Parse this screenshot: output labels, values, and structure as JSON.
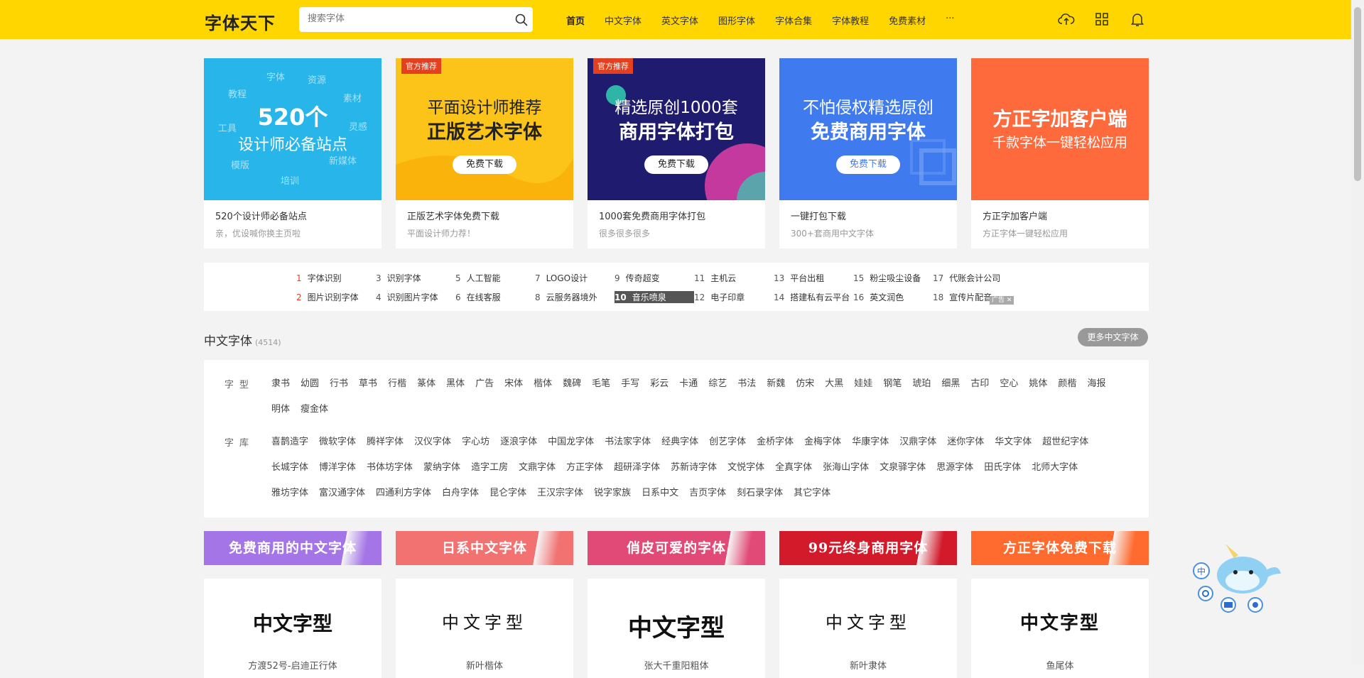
{
  "header": {
    "logo": "字体天下",
    "search_placeholder": "搜索字体",
    "nav": [
      "首页",
      "中文字体",
      "英文字体",
      "图形字体",
      "字体合集",
      "字体教程",
      "免费素材",
      "···"
    ],
    "icons": [
      "upload-cloud-icon",
      "grid-apps-icon",
      "bell-icon"
    ],
    "accent_color": "#ffd600"
  },
  "banners": [
    {
      "bg": "#28b6ea",
      "tag": "",
      "line1": "520个",
      "line2": "设计师必备站点",
      "button": "",
      "title": "520个设计师必备站点",
      "subtitle": "亲，优设喊你换主页啦",
      "words": [
        "字体",
        "教程",
        "资源",
        "素材",
        "工具",
        "灵感",
        "模版",
        "新媒体",
        "培训"
      ]
    },
    {
      "bg": "#fcc419",
      "tag": "官方推荐",
      "line1": "平面设计师推荐",
      "line2": "正版艺术字体",
      "button": "免费下载",
      "title": "正版艺术字体免费下载",
      "subtitle": "平面设计师力荐！"
    },
    {
      "bg": "#1f1b6e",
      "tag": "官方推荐",
      "line1": "精选原创1000套",
      "line2": "商用字体打包",
      "button": "免费下载",
      "title": "1000套免费商用字体打包",
      "subtitle": "很多很多很多"
    },
    {
      "bg": "#3f7bee",
      "tag": "",
      "line1": "不怕侵权精选原创",
      "line2": "免费商用字体",
      "button": "免费下载",
      "title": "一键打包下载",
      "subtitle": "300+套商用中文字体"
    },
    {
      "bg": "#ff6a3d",
      "tag": "",
      "line1": "千款字体一键轻松应用",
      "line2": "方正字加客户端",
      "button": "",
      "title": "方正字加客户端",
      "subtitle": "方正字体一键轻松应用"
    }
  ],
  "hot_searches": [
    {
      "rank": "1",
      "text": "字体识别"
    },
    {
      "rank": "3",
      "text": "识别字体"
    },
    {
      "rank": "5",
      "text": "人工智能"
    },
    {
      "rank": "7",
      "text": "LOGO设计"
    },
    {
      "rank": "9",
      "text": "传奇超变"
    },
    {
      "rank": "11",
      "text": "主机云"
    },
    {
      "rank": "13",
      "text": "平台出租"
    },
    {
      "rank": "15",
      "text": "粉尘吸尘设备"
    },
    {
      "rank": "17",
      "text": "代账会计公司"
    },
    {
      "rank": "2",
      "text": "图片识别字体"
    },
    {
      "rank": "4",
      "text": "识别图片字体"
    },
    {
      "rank": "6",
      "text": "在线客服"
    },
    {
      "rank": "8",
      "text": "云服务器境外"
    },
    {
      "rank": "10",
      "text": "音乐喷泉"
    },
    {
      "rank": "12",
      "text": "电子印章"
    },
    {
      "rank": "14",
      "text": "搭建私有云平台"
    },
    {
      "rank": "16",
      "text": "英文润色"
    },
    {
      "rank": "18",
      "text": "宣传片配音"
    }
  ],
  "ad_badge": "广告 ✕",
  "section": {
    "title": "中文字体",
    "count": "(4514)",
    "more": "更多中文字体"
  },
  "filters": {
    "type_label": "字型",
    "types": [
      "隶书",
      "幼圆",
      "行书",
      "草书",
      "行楷",
      "篆体",
      "黑体",
      "广告",
      "宋体",
      "楷体",
      "魏碑",
      "毛笔",
      "手写",
      "彩云",
      "卡通",
      "综艺",
      "书法",
      "新魏",
      "仿宋",
      "大黑",
      "娃娃",
      "钢笔",
      "琥珀",
      "细黑",
      "古印",
      "空心",
      "姚体",
      "颜楷",
      "海报",
      "明体",
      "瘦金体"
    ],
    "lib_label": "字库",
    "libs": [
      "喜鹊造字",
      "微软字体",
      "腾祥字体",
      "汉仪字体",
      "字心坊",
      "逐浪字体",
      "中国龙字体",
      "书法家字体",
      "经典字体",
      "创艺字体",
      "金桥字体",
      "金梅字体",
      "华康字体",
      "汉鼎字体",
      "迷你字体",
      "华文字体",
      "超世纪字体",
      "长城字体",
      "博洋字体",
      "书体坊字体",
      "蒙纳字体",
      "造字工房",
      "文鼎字体",
      "方正字体",
      "超研泽字体",
      "苏新诗字体",
      "文悦字体",
      "全真字体",
      "张海山字体",
      "文泉驿字体",
      "思源字体",
      "田氏字体",
      "北师大字体",
      "雅坊字体",
      "富汉通字体",
      "四通利方字体",
      "白舟字体",
      "昆仑字体",
      "王汉宗字体",
      "锐字家族",
      "日系中文",
      "吉页字体",
      "刻石录字体",
      "其它字体"
    ]
  },
  "collections": [
    {
      "label": "免费商用的中文字体",
      "bg": "#a475e6"
    },
    {
      "label": "日系中文字体",
      "bg": "#f27272"
    },
    {
      "label": "俏皮可爱的字体",
      "bg": "#e14a76"
    },
    {
      "label": "99元终身商用字体",
      "bg": "#d31a2b"
    },
    {
      "label": "方正字体免费下载",
      "bg": "#ff6a2e"
    }
  ],
  "font_cards": [
    {
      "sample": "中文字型",
      "name": "方渡52号-启迪正行体"
    },
    {
      "sample": "中文字型",
      "name": "新叶楷体"
    },
    {
      "sample": "中文字型",
      "name": "张大千重阳粗体"
    },
    {
      "sample": "中文字型",
      "name": "新叶隶体"
    },
    {
      "sample": "中文字型",
      "name": "鱼尾体"
    }
  ]
}
